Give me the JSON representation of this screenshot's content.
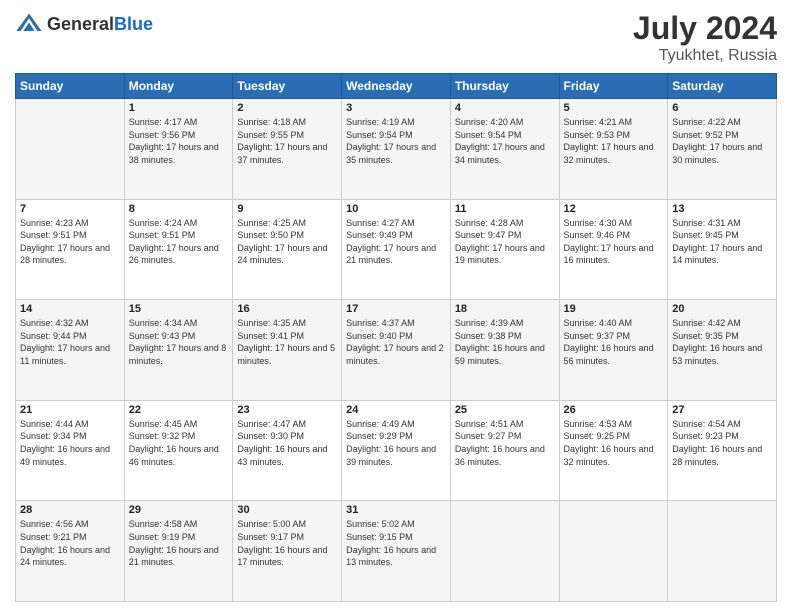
{
  "header": {
    "logo_general": "General",
    "logo_blue": "Blue",
    "month_year": "July 2024",
    "location": "Tyukhtet, Russia"
  },
  "days_of_week": [
    "Sunday",
    "Monday",
    "Tuesday",
    "Wednesday",
    "Thursday",
    "Friday",
    "Saturday"
  ],
  "weeks": [
    [
      {
        "day": "",
        "sunrise": "",
        "sunset": "",
        "daylight": ""
      },
      {
        "day": "1",
        "sunrise": "Sunrise: 4:17 AM",
        "sunset": "Sunset: 9:56 PM",
        "daylight": "Daylight: 17 hours and 38 minutes."
      },
      {
        "day": "2",
        "sunrise": "Sunrise: 4:18 AM",
        "sunset": "Sunset: 9:55 PM",
        "daylight": "Daylight: 17 hours and 37 minutes."
      },
      {
        "day": "3",
        "sunrise": "Sunrise: 4:19 AM",
        "sunset": "Sunset: 9:54 PM",
        "daylight": "Daylight: 17 hours and 35 minutes."
      },
      {
        "day": "4",
        "sunrise": "Sunrise: 4:20 AM",
        "sunset": "Sunset: 9:54 PM",
        "daylight": "Daylight: 17 hours and 34 minutes."
      },
      {
        "day": "5",
        "sunrise": "Sunrise: 4:21 AM",
        "sunset": "Sunset: 9:53 PM",
        "daylight": "Daylight: 17 hours and 32 minutes."
      },
      {
        "day": "6",
        "sunrise": "Sunrise: 4:22 AM",
        "sunset": "Sunset: 9:52 PM",
        "daylight": "Daylight: 17 hours and 30 minutes."
      }
    ],
    [
      {
        "day": "7",
        "sunrise": "Sunrise: 4:23 AM",
        "sunset": "Sunset: 9:51 PM",
        "daylight": "Daylight: 17 hours and 28 minutes."
      },
      {
        "day": "8",
        "sunrise": "Sunrise: 4:24 AM",
        "sunset": "Sunset: 9:51 PM",
        "daylight": "Daylight: 17 hours and 26 minutes."
      },
      {
        "day": "9",
        "sunrise": "Sunrise: 4:25 AM",
        "sunset": "Sunset: 9:50 PM",
        "daylight": "Daylight: 17 hours and 24 minutes."
      },
      {
        "day": "10",
        "sunrise": "Sunrise: 4:27 AM",
        "sunset": "Sunset: 9:49 PM",
        "daylight": "Daylight: 17 hours and 21 minutes."
      },
      {
        "day": "11",
        "sunrise": "Sunrise: 4:28 AM",
        "sunset": "Sunset: 9:47 PM",
        "daylight": "Daylight: 17 hours and 19 minutes."
      },
      {
        "day": "12",
        "sunrise": "Sunrise: 4:30 AM",
        "sunset": "Sunset: 9:46 PM",
        "daylight": "Daylight: 17 hours and 16 minutes."
      },
      {
        "day": "13",
        "sunrise": "Sunrise: 4:31 AM",
        "sunset": "Sunset: 9:45 PM",
        "daylight": "Daylight: 17 hours and 14 minutes."
      }
    ],
    [
      {
        "day": "14",
        "sunrise": "Sunrise: 4:32 AM",
        "sunset": "Sunset: 9:44 PM",
        "daylight": "Daylight: 17 hours and 11 minutes."
      },
      {
        "day": "15",
        "sunrise": "Sunrise: 4:34 AM",
        "sunset": "Sunset: 9:43 PM",
        "daylight": "Daylight: 17 hours and 8 minutes."
      },
      {
        "day": "16",
        "sunrise": "Sunrise: 4:35 AM",
        "sunset": "Sunset: 9:41 PM",
        "daylight": "Daylight: 17 hours and 5 minutes."
      },
      {
        "day": "17",
        "sunrise": "Sunrise: 4:37 AM",
        "sunset": "Sunset: 9:40 PM",
        "daylight": "Daylight: 17 hours and 2 minutes."
      },
      {
        "day": "18",
        "sunrise": "Sunrise: 4:39 AM",
        "sunset": "Sunset: 9:38 PM",
        "daylight": "Daylight: 16 hours and 59 minutes."
      },
      {
        "day": "19",
        "sunrise": "Sunrise: 4:40 AM",
        "sunset": "Sunset: 9:37 PM",
        "daylight": "Daylight: 16 hours and 56 minutes."
      },
      {
        "day": "20",
        "sunrise": "Sunrise: 4:42 AM",
        "sunset": "Sunset: 9:35 PM",
        "daylight": "Daylight: 16 hours and 53 minutes."
      }
    ],
    [
      {
        "day": "21",
        "sunrise": "Sunrise: 4:44 AM",
        "sunset": "Sunset: 9:34 PM",
        "daylight": "Daylight: 16 hours and 49 minutes."
      },
      {
        "day": "22",
        "sunrise": "Sunrise: 4:45 AM",
        "sunset": "Sunset: 9:32 PM",
        "daylight": "Daylight: 16 hours and 46 minutes."
      },
      {
        "day": "23",
        "sunrise": "Sunrise: 4:47 AM",
        "sunset": "Sunset: 9:30 PM",
        "daylight": "Daylight: 16 hours and 43 minutes."
      },
      {
        "day": "24",
        "sunrise": "Sunrise: 4:49 AM",
        "sunset": "Sunset: 9:29 PM",
        "daylight": "Daylight: 16 hours and 39 minutes."
      },
      {
        "day": "25",
        "sunrise": "Sunrise: 4:51 AM",
        "sunset": "Sunset: 9:27 PM",
        "daylight": "Daylight: 16 hours and 36 minutes."
      },
      {
        "day": "26",
        "sunrise": "Sunrise: 4:53 AM",
        "sunset": "Sunset: 9:25 PM",
        "daylight": "Daylight: 16 hours and 32 minutes."
      },
      {
        "day": "27",
        "sunrise": "Sunrise: 4:54 AM",
        "sunset": "Sunset: 9:23 PM",
        "daylight": "Daylight: 16 hours and 28 minutes."
      }
    ],
    [
      {
        "day": "28",
        "sunrise": "Sunrise: 4:56 AM",
        "sunset": "Sunset: 9:21 PM",
        "daylight": "Daylight: 16 hours and 24 minutes."
      },
      {
        "day": "29",
        "sunrise": "Sunrise: 4:58 AM",
        "sunset": "Sunset: 9:19 PM",
        "daylight": "Daylight: 16 hours and 21 minutes."
      },
      {
        "day": "30",
        "sunrise": "Sunrise: 5:00 AM",
        "sunset": "Sunset: 9:17 PM",
        "daylight": "Daylight: 16 hours and 17 minutes."
      },
      {
        "day": "31",
        "sunrise": "Sunrise: 5:02 AM",
        "sunset": "Sunset: 9:15 PM",
        "daylight": "Daylight: 16 hours and 13 minutes."
      },
      {
        "day": "",
        "sunrise": "",
        "sunset": "",
        "daylight": ""
      },
      {
        "day": "",
        "sunrise": "",
        "sunset": "",
        "daylight": ""
      },
      {
        "day": "",
        "sunrise": "",
        "sunset": "",
        "daylight": ""
      }
    ]
  ]
}
